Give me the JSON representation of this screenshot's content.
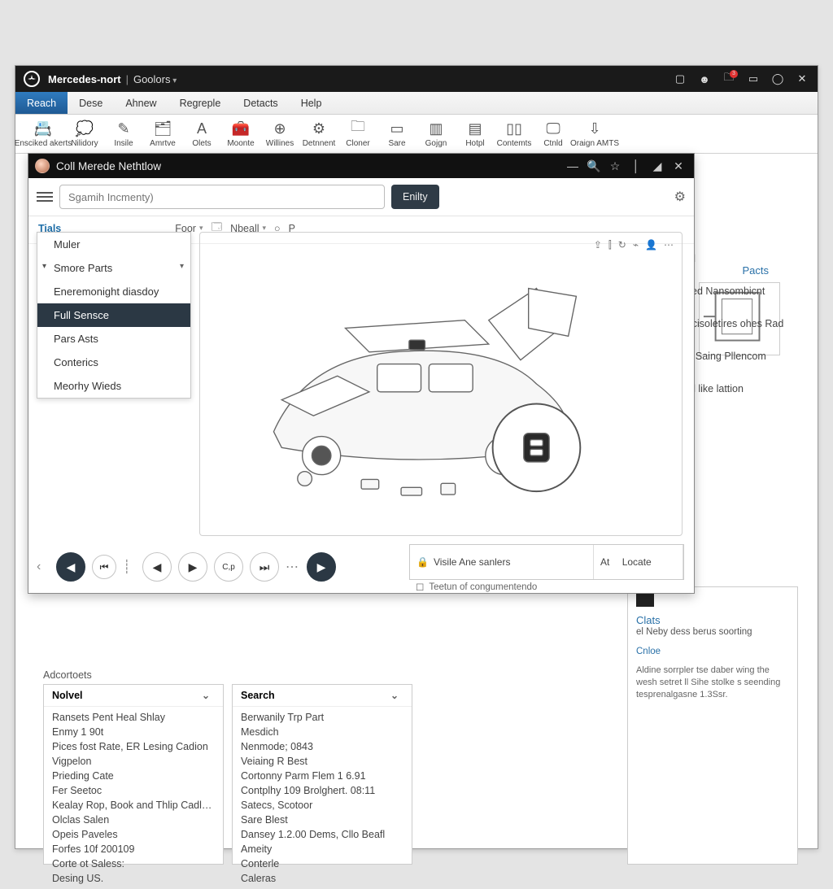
{
  "titlebar": {
    "brand": "Mercedes-nort",
    "app": "Goolors",
    "icons": {
      "help": "?",
      "notify_badge": "3"
    }
  },
  "menubar": {
    "items": [
      "Reach",
      "Dese",
      "Ahnew",
      "Regreple",
      "Detacts",
      "Help"
    ],
    "active_index": 0
  },
  "toolbar": [
    {
      "icon": "📇",
      "label": "Ensciked akerts"
    },
    {
      "icon": "💭",
      "label": "Nilidory"
    },
    {
      "icon": "✎",
      "label": "Insile"
    },
    {
      "icon": "🗂",
      "label": "Amrtve"
    },
    {
      "icon": "A",
      "label": "Olets"
    },
    {
      "icon": "🧰",
      "label": "Moonte"
    },
    {
      "icon": "⊕",
      "label": "Willines"
    },
    {
      "icon": "⚙",
      "label": "Detnnent"
    },
    {
      "icon": "🗀",
      "label": "Cloner"
    },
    {
      "icon": "▭",
      "label": "Sare"
    },
    {
      "icon": "▥",
      "label": "Gojgn"
    },
    {
      "icon": "▤",
      "label": "Hotpl"
    },
    {
      "icon": "▯▯",
      "label": "Contemts"
    },
    {
      "icon": "🖵",
      "label": "Ctnld"
    },
    {
      "icon": "⇩",
      "label": "Oraign AMTS"
    }
  ],
  "inner": {
    "title": "Coll Merede Nethtlow",
    "search_placeholder": "Sgamih Incmenty)",
    "entity_btn": "Enilty",
    "subbar": {
      "link": "Tials",
      "foor": "Foor",
      "nbeall": "Nbeall",
      "p": "P"
    },
    "side_menu": [
      {
        "label": "Muler"
      },
      {
        "label": "Smore Parts",
        "hasmore": true,
        "caretdown": true
      },
      {
        "label": "Eneremonight diasdoy"
      },
      {
        "label": "Full Sensce",
        "selected": true
      },
      {
        "label": "Pars Asts"
      },
      {
        "label": "Conterics"
      },
      {
        "label": "Meorhy Wieds"
      }
    ],
    "canvas_tools": [
      "⇪",
      "⫿",
      "↻",
      "⌁",
      "👤",
      "⋯"
    ],
    "player_label": "C,p",
    "locate": {
      "left_label": "Visile Ane sanlers",
      "right_prefix": "At",
      "right_label": "Locate",
      "subline": "Teetun of congumentendo"
    }
  },
  "bg": {
    "parts_hd": "Pacts",
    "right_items": [
      "ed",
      "itled Nansombicnt",
      "it cisoletires ohes Rad",
      "at Saing Pllencom",
      "ed like lattion"
    ]
  },
  "advisors": "Adcortoets",
  "panel1": {
    "title": "Nolvel",
    "rows": [
      "Ransets Pent Heal Shlay",
      "Enmy 1 90t",
      "Pices fost Rate, ER Lesing Cadion",
      "Vigpelon",
      "Prieding Cate",
      "Fer Seetoc",
      "Kealay Rop, Book and Thlip Cadlery",
      "Olclas Salen",
      "Opeis Paveles",
      "Forfes 10f 200109",
      "Corte ot Saless:",
      "Desing US."
    ]
  },
  "panel2": {
    "title": "Search",
    "rows": [
      "Berwanily Trp Part",
      "Mesdich",
      "Nenmode; 0843",
      "Veiaing R Best",
      "Cortonny Parm Flem 1 6.91",
      "Contplhy 109 Brolghert. 08:11",
      "Satecs, Scotoor",
      "Sare Blest",
      "Dansey 1.2.00 Dems, Cllo Beafl",
      "Ameity",
      "Conterle",
      "Caleras"
    ]
  },
  "panel3": {
    "hd": "Clats",
    "sub": "el Neby dess berus soorting",
    "accent": "Cnloe",
    "body": "Aldine sorrpler tse daber wing the wesh setret ll Sihe stolke s seending tesprenalgasne 1.3Ssr."
  }
}
